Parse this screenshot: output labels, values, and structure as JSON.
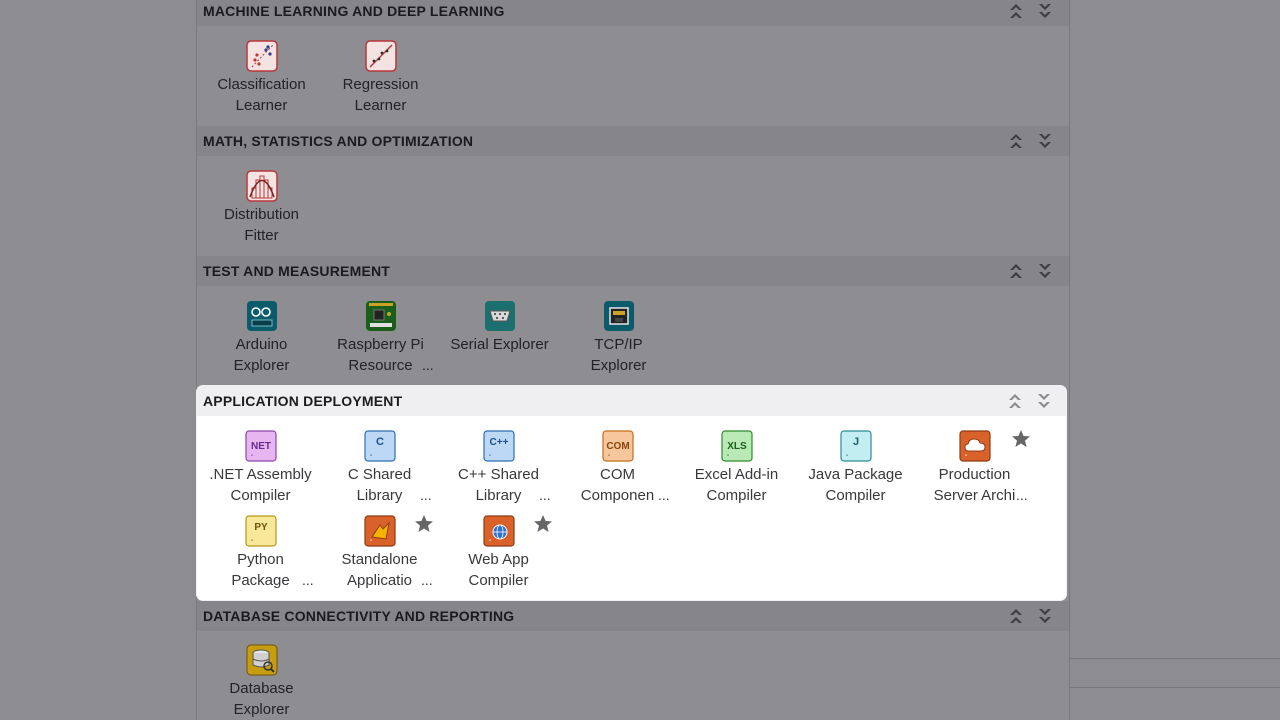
{
  "colors": {
    "overlay_bg": "#8d8c91",
    "panel_bg": "#ffffff",
    "panel_header_bg": "#efeff1",
    "star": "#666666"
  },
  "sections": [
    {
      "title": "MACHINE LEARNING AND DEEP LEARNING",
      "apps": [
        {
          "line1": "Classification",
          "line2": "Learner",
          "icon": "classification-learner-icon"
        },
        {
          "line1": "Regression",
          "line2": "Learner",
          "icon": "regression-learner-icon"
        }
      ]
    },
    {
      "title": "MATH, STATISTICS AND OPTIMIZATION",
      "apps": [
        {
          "line1": "Distribution",
          "line2": "Fitter",
          "icon": "distribution-fitter-icon"
        }
      ]
    },
    {
      "title": "TEST AND MEASUREMENT",
      "apps": [
        {
          "line1": "Arduino",
          "line2": "Explorer",
          "icon": "arduino-explorer-icon"
        },
        {
          "line1": "Raspberry Pi",
          "line2": "Resource",
          "ellipsis": "...",
          "icon": "raspberry-pi-icon"
        },
        {
          "line1": "Serial Explorer",
          "line2": "",
          "icon": "serial-explorer-icon"
        },
        {
          "line1": "TCP/IP",
          "line2": "Explorer",
          "icon": "tcpip-explorer-icon"
        }
      ]
    },
    {
      "title": "APPLICATION DEPLOYMENT",
      "apps": [
        {
          "line1": ".NET Assembly",
          "line2": "Compiler",
          "badge": "NET",
          "icon": "net-assembly-icon"
        },
        {
          "line1": "C Shared",
          "line2": "Library",
          "ellipsis": "...",
          "badge": "C",
          "icon": "c-shared-library-icon"
        },
        {
          "line1": "C++ Shared",
          "line2": "Library",
          "ellipsis": "...",
          "badge": "C++",
          "icon": "cpp-shared-library-icon"
        },
        {
          "line1": "COM",
          "line2": "Componen",
          "ellipsis": "...",
          "badge": "COM",
          "icon": "com-component-icon"
        },
        {
          "line1": "Excel Add-in",
          "line2": "Compiler",
          "badge": "XLS",
          "icon": "excel-addin-icon"
        },
        {
          "line1": "Java Package",
          "line2": "Compiler",
          "badge": "J",
          "icon": "java-package-icon"
        },
        {
          "line1": "Production",
          "line2": "Server Archi",
          "ellipsis": "...",
          "icon": "production-server-icon",
          "favorite": true
        },
        {
          "line1": "Python",
          "line2": "Package",
          "ellipsis": "...",
          "badge": "PY",
          "icon": "python-package-icon"
        },
        {
          "line1": "Standalone",
          "line2": "Applicatio",
          "ellipsis": "...",
          "icon": "standalone-application-icon",
          "favorite": true
        },
        {
          "line1": "Web App",
          "line2": "Compiler",
          "icon": "web-app-compiler-icon",
          "favorite": true
        }
      ]
    },
    {
      "title": "DATABASE CONNECTIVITY AND REPORTING",
      "apps": [
        {
          "line1": "Database",
          "line2": "Explorer",
          "icon": "database-explorer-icon"
        }
      ]
    }
  ]
}
